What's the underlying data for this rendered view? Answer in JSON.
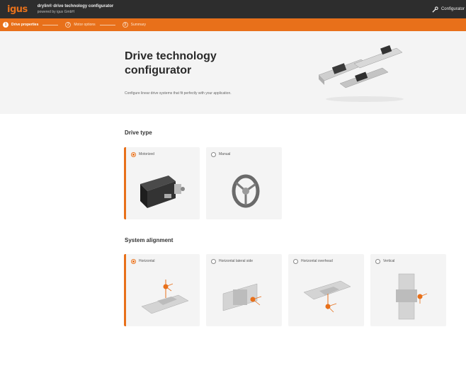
{
  "header": {
    "logo": "igus",
    "app_title": "drylin® drive technology configurator",
    "app_subtitle": "powered by igus GmbH",
    "right_label": "Configurator"
  },
  "steps": [
    {
      "label": "Drive properties",
      "number": "1"
    },
    {
      "label": "Motor options",
      "number": "2"
    },
    {
      "label": "Summary",
      "number": "3"
    }
  ],
  "hero": {
    "title": "Drive technology configurator",
    "subtitle": "Configure linear drive systems that fit perfectly with your application."
  },
  "drive_type": {
    "title": "Drive type",
    "options": [
      {
        "label": "Motorized",
        "selected": true
      },
      {
        "label": "Manual",
        "selected": false
      }
    ]
  },
  "system_alignment": {
    "title": "System alignment",
    "options": [
      {
        "label": "Horizontal",
        "selected": true
      },
      {
        "label": "Horizontal lateral side",
        "selected": false
      },
      {
        "label": "Horizontal overhead",
        "selected": false
      },
      {
        "label": "Vertical",
        "selected": false
      }
    ]
  },
  "colors": {
    "accent": "#e8701a",
    "header": "#2d2d2d"
  }
}
